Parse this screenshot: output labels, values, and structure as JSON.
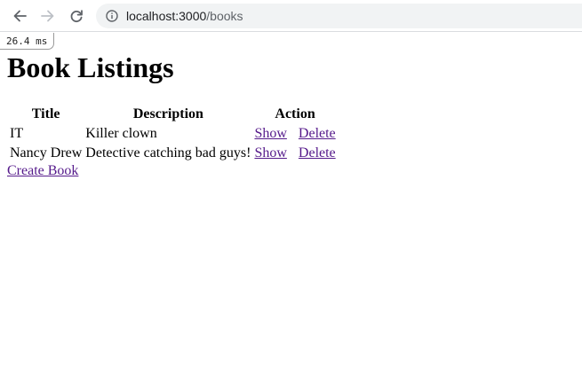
{
  "browser": {
    "url_host": "localhost:3000",
    "url_path": "/books",
    "icons": {
      "back": "arrow-left-icon",
      "forward": "arrow-right-icon",
      "reload": "reload-icon",
      "site_info": "info-circle-icon"
    }
  },
  "perf_badge": "26.4 ms",
  "page": {
    "title": "Book Listings",
    "table": {
      "headers": [
        "Title",
        "Description",
        "Action"
      ],
      "rows": [
        {
          "title": "IT",
          "description": "Killer clown",
          "show": "Show",
          "delete": "Delete"
        },
        {
          "title": "Nancy Drew",
          "description": "Detective catching bad guys!",
          "show": "Show",
          "delete": "Delete"
        }
      ]
    },
    "create_link": "Create Book"
  },
  "colors": {
    "visited_link": "#551a8b",
    "omnibox_bg": "#f1f3f4",
    "nav_active": "#5f6368",
    "nav_disabled": "#bdc1c6"
  }
}
